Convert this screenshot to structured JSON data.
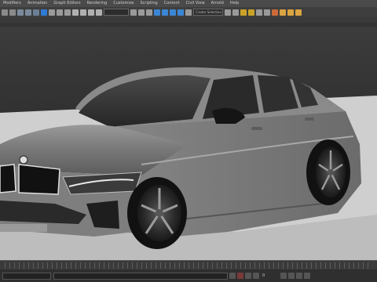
{
  "menu": {
    "items": [
      "Modifiers",
      "Animation",
      "Graph Editors",
      "Rendering",
      "Customize",
      "Scripting",
      "Content",
      "Civil View",
      "Arnold",
      "Help"
    ]
  },
  "toolbar": {
    "selection_filter": "",
    "named_selection": "Create Selection Set"
  },
  "ribbon": {
    "tabs": [
      "",
      ""
    ]
  },
  "viewport": {
    "label": ""
  },
  "colors": {
    "background": "#2b2b2b",
    "ground": "#cfcfcf",
    "car_body": "#7d7d7d",
    "accent_toolbar": "#2e7bd6"
  },
  "statusbar": {
    "frame_value": "0"
  }
}
